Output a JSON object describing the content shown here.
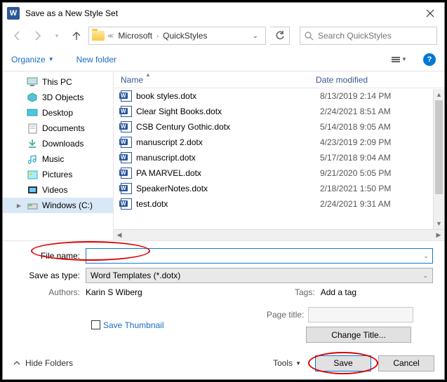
{
  "title": "Save as a New Style Set",
  "breadcrumb": {
    "a": "Microsoft",
    "b": "QuickStyles"
  },
  "search": {
    "placeholder": "Search QuickStyles"
  },
  "toolbar": {
    "organize": "Organize",
    "newfolder": "New folder"
  },
  "tree": {
    "thispc": "This PC",
    "items": [
      {
        "label": "3D Objects"
      },
      {
        "label": "Desktop"
      },
      {
        "label": "Documents"
      },
      {
        "label": "Downloads"
      },
      {
        "label": "Music"
      },
      {
        "label": "Pictures"
      },
      {
        "label": "Videos"
      },
      {
        "label": "Windows (C:)"
      }
    ]
  },
  "columns": {
    "name": "Name",
    "date": "Date modified"
  },
  "files": [
    {
      "name": "book styles.dotx",
      "date": "8/13/2019 2:14 PM"
    },
    {
      "name": "Clear Sight Books.dotx",
      "date": "2/24/2021 8:51 AM"
    },
    {
      "name": "CSB Century Gothic.dotx",
      "date": "5/14/2018 9:05 AM"
    },
    {
      "name": "manuscript 2.dotx",
      "date": "4/23/2019 2:09 PM"
    },
    {
      "name": "manuscript.dotx",
      "date": "5/17/2018 9:04 AM"
    },
    {
      "name": "PA MARVEL.dotx",
      "date": "9/21/2020 5:05 PM"
    },
    {
      "name": "SpeakerNotes.dotx",
      "date": "2/18/2021 1:50 PM"
    },
    {
      "name": "test.dotx",
      "date": "2/24/2021 9:31 AM"
    }
  ],
  "form": {
    "filename_label": "File name:",
    "filename_value": "",
    "type_label": "Save as type:",
    "type_value": "Word Templates (*.dotx)",
    "authors_label": "Authors:",
    "authors_value": "Karin S Wiberg",
    "tags_label": "Tags:",
    "tags_value": "Add a tag",
    "save_thumbnail": "Save Thumbnail",
    "page_title_label": "Page title:",
    "change_title": "Change Title..."
  },
  "bottom": {
    "hide_folders": "Hide Folders",
    "tools": "Tools",
    "save": "Save",
    "cancel": "Cancel"
  }
}
